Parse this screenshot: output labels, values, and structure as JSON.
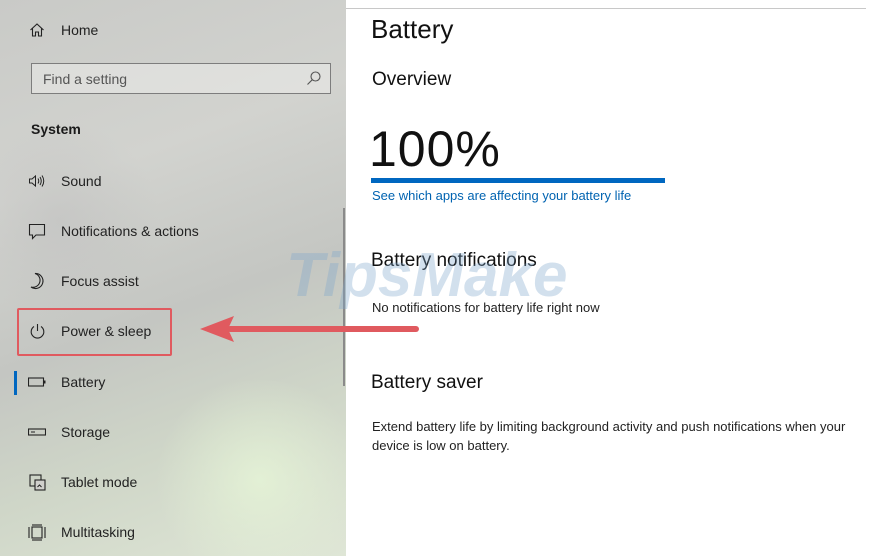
{
  "sidebar": {
    "home_label": "Home",
    "search": {
      "placeholder": "Find a setting"
    },
    "section_title": "System",
    "items": [
      {
        "label": "Sound",
        "icon": "speaker-icon"
      },
      {
        "label": "Notifications & actions",
        "icon": "notification-icon"
      },
      {
        "label": "Focus assist",
        "icon": "moon-icon"
      },
      {
        "label": "Power & sleep",
        "icon": "power-icon"
      },
      {
        "label": "Battery",
        "icon": "battery-icon"
      },
      {
        "label": "Storage",
        "icon": "storage-icon"
      },
      {
        "label": "Tablet mode",
        "icon": "tablet-mode-icon"
      },
      {
        "label": "Multitasking",
        "icon": "multitasking-icon"
      }
    ],
    "selected": "Battery"
  },
  "main": {
    "page_title": "Battery",
    "overview_heading": "Overview",
    "battery_percent_text": "100%",
    "battery_level": 1.0,
    "apps_link": "See which apps are affecting your battery life",
    "notifications_heading": "Battery notifications",
    "notifications_text": "No notifications for battery life right now",
    "saver_heading": "Battery saver",
    "saver_text": "Extend battery life by limiting background activity and push notifications when your device is low on battery."
  },
  "annotations": {
    "highlight_color": "#e05a5f",
    "accent_color": "#0067c0"
  },
  "watermark_text": "TipsMake"
}
